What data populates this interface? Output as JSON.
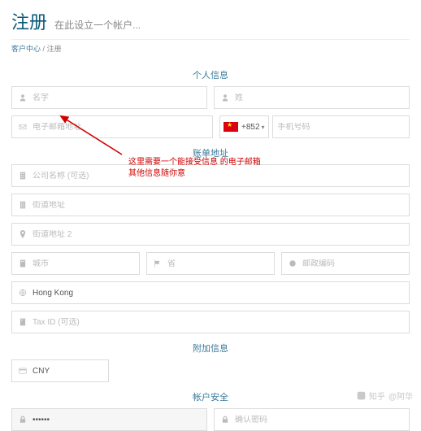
{
  "header": {
    "title": "注册",
    "subtitle": "在此设立一个帐户..."
  },
  "breadcrumb": {
    "home": "客户中心",
    "sep": "/",
    "current": "注册"
  },
  "sections": {
    "personal": "个人信息",
    "billing": "账单地址",
    "additional": "附加信息",
    "security": "帐户安全"
  },
  "fields": {
    "first_name": "名字",
    "last_name": "姓",
    "email": "电子邮箱地址",
    "dialcode": "+852",
    "phone": "手机号码",
    "company": "公司名称 (可选)",
    "address1": "街道地址",
    "address2": "街道地址 2",
    "city": "城市",
    "province": "省",
    "postcode": "邮政编码",
    "country_value": "Hong Kong",
    "taxid": "Tax ID (可选)",
    "currency_value": "CNY",
    "password_value": "••••••",
    "confirm_password": "确认密码"
  },
  "annotation": {
    "line1": "这里需要一个能接受信息 的电子邮箱",
    "line2": "其他信息随你意"
  },
  "watermark": {
    "site": "知乎",
    "author": "@阿华"
  }
}
